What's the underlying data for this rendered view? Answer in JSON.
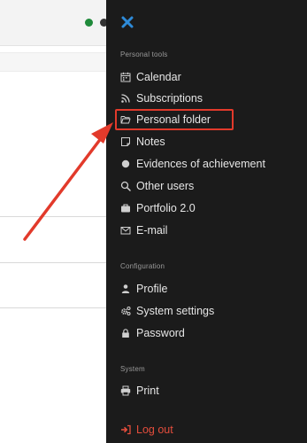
{
  "drawer": {
    "close_icon": "close-icon",
    "sections": [
      {
        "label": "Personal tools",
        "items": [
          {
            "label": "Calendar",
            "icon": "calendar-icon"
          },
          {
            "label": "Subscriptions",
            "icon": "rss-icon"
          },
          {
            "label": "Personal folder",
            "icon": "folder-icon",
            "highlighted": true
          },
          {
            "label": "Notes",
            "icon": "note-icon"
          },
          {
            "label": "Evidences of achievement",
            "icon": "badge-icon"
          },
          {
            "label": "Other users",
            "icon": "search-icon"
          },
          {
            "label": "Portfolio 2.0",
            "icon": "briefcase-icon"
          },
          {
            "label": "E-mail",
            "icon": "envelope-icon"
          }
        ]
      },
      {
        "label": "Configuration",
        "items": [
          {
            "label": "Profile",
            "icon": "user-icon"
          },
          {
            "label": "System settings",
            "icon": "gears-icon"
          },
          {
            "label": "Password",
            "icon": "lock-icon"
          }
        ]
      },
      {
        "label": "System",
        "items": [
          {
            "label": "Print",
            "icon": "print-icon"
          }
        ]
      }
    ],
    "logout": {
      "label": "Log out",
      "icon": "logout-icon"
    }
  },
  "annotation": {
    "color": "#e23a2b"
  },
  "colors": {
    "drawer_bg": "#1b1b1b",
    "accent_blue": "#2e8bd9",
    "logout_red": "#e34d3c",
    "status_green": "#1f8a3a"
  }
}
